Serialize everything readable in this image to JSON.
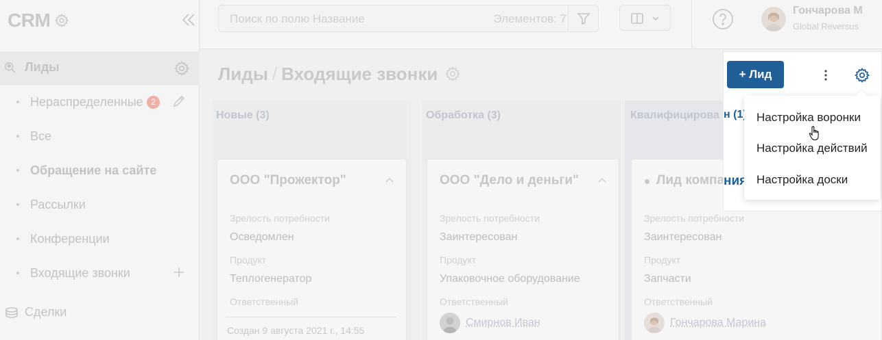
{
  "app": {
    "name": "CRM"
  },
  "sidebar": {
    "main_item": "Лиды",
    "items": [
      {
        "label": "Нераспределенные",
        "badge": "2"
      },
      {
        "label": "Все"
      },
      {
        "label": "Обращение на сайте"
      },
      {
        "label": "Рассылки"
      },
      {
        "label": "Конференции"
      },
      {
        "label": "Входящие звонки"
      }
    ],
    "deals": "Сделки"
  },
  "topbar": {
    "search_placeholder": "Поиск по полю Название",
    "count": "Элементов: 7",
    "user_name": "Гончарова М",
    "user_company": "Global Reversus"
  },
  "page": {
    "section": "Лиды",
    "separator": "/",
    "funnel": "Входящие звонки"
  },
  "columns": [
    {
      "title": "Новые (3)",
      "card": {
        "title": "ООО \"Прожектор\"",
        "label_maturity": "Зрелость потребности",
        "maturity": "Осведомлен",
        "label_product": "Продукт",
        "product": "Теплогенератор",
        "label_owner": "Ответственный",
        "created": "Создан  9 августа 2021 г., 14:55"
      }
    },
    {
      "title": "Обработка (3)",
      "card": {
        "title": "ООО \"Дело и деньги\"",
        "label_maturity": "Зрелость потребности",
        "maturity": "Заинтересован",
        "label_product": "Продукт",
        "product": "Упаковочное оборудование",
        "label_owner": "Ответственный",
        "owner": "Смирнов Иван"
      }
    },
    {
      "title": "Квалифицирова",
      "title_tail": "н (1)",
      "card": {
        "title": "Лид компа",
        "title_tail": "ния",
        "label_maturity": "Зрелость потребности",
        "maturity": "Заинтересован",
        "label_product": "Продукт",
        "product": "Запчасти",
        "label_owner": "Ответственный",
        "owner": "Гончарова Марина"
      }
    }
  ],
  "actions": {
    "add_label": "+ Лид"
  },
  "dropdown": {
    "items": [
      "Настройка воронки",
      "Настройка действий",
      "Настройка доски"
    ]
  },
  "colors": {
    "accent": "#1f5e96",
    "badge": "#f0b0a8"
  }
}
